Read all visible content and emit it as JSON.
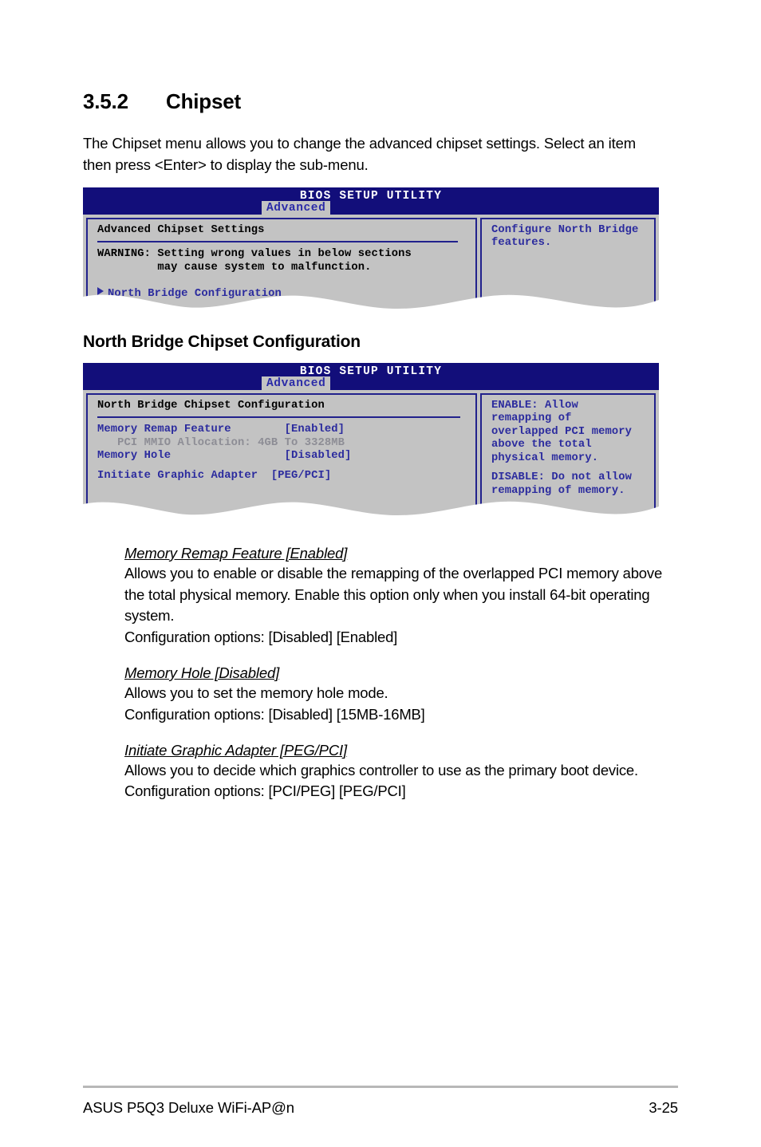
{
  "section": {
    "number": "3.5.2",
    "title": "Chipset",
    "intro": "The Chipset menu allows you to change the advanced chipset settings. Select an item then press <Enter> to display the sub-menu.",
    "subheading": "North Bridge Chipset Configuration"
  },
  "bios_screen_1": {
    "title": "BIOS SETUP UTILITY",
    "active_tab": "Advanced",
    "left_pane": {
      "heading": "Advanced Chipset Settings",
      "warning_line1": "WARNING: Setting wrong values in below sections",
      "warning_line2": "         may cause system to malfunction.",
      "submenu_item": "North Bridge Configuration"
    },
    "right_pane": {
      "help_line1": "Configure North Bridge",
      "help_line2": "features."
    }
  },
  "bios_screen_2": {
    "title": "BIOS SETUP UTILITY",
    "active_tab": "Advanced",
    "left_pane": {
      "heading": "North Bridge Chipset Configuration",
      "items": [
        {
          "label": "Memory Remap Feature",
          "value": "[Enabled]"
        },
        {
          "label": "  PCI MMIO Allocation: 4GB To 3328MB",
          "value": ""
        },
        {
          "label": "Memory Hole",
          "value": "[Disabled]"
        },
        {
          "label": "Initiate Graphic Adapter",
          "value": "[PEG/PCI]"
        }
      ],
      "row1_label": "Memory Remap Feature",
      "row1_value": "[Enabled]",
      "row2_text": "   PCI MMIO Allocation: 4GB To 3328MB",
      "row3_label": "Memory Hole",
      "row3_value": "[Disabled]",
      "row4_text": "Initiate Graphic Adapter  [PEG/PCI]"
    },
    "right_pane": {
      "help_enable_l1": "ENABLE: Allow",
      "help_enable_l2": "remapping of",
      "help_enable_l3": "overlapped PCI memory",
      "help_enable_l4": "above the total",
      "help_enable_l5": "physical memory.",
      "help_disable_l1": "DISABLE: Do not allow",
      "help_disable_l2": "remapping of memory."
    }
  },
  "descriptions": [
    {
      "title": "Memory Remap Feature [Enabled]",
      "body": "Allows you to enable or disable the remapping of the overlapped PCI memory above the total physical memory. Enable this option only when you install 64-bit operating system.",
      "options": "Configuration options: [Disabled] [Enabled]"
    },
    {
      "title": "Memory Hole [Disabled]",
      "body": "Allows you to set the memory hole mode.",
      "options": "Configuration options: [Disabled] [15MB-16MB]"
    },
    {
      "title": "Initiate Graphic Adapter [PEG/PCI]",
      "body": "Allows you to decide which graphics controller to use as the primary boot device.",
      "options": "Configuration options: [PCI/PEG] [PEG/PCI]"
    }
  ],
  "footer": {
    "product": "ASUS P5Q3 Deluxe WiFi-AP@n",
    "page_number": "3-25"
  },
  "colors": {
    "bios_header_blue": "#120e7a",
    "bios_border_blue": "#21218c",
    "bios_body_gray": "#c3c3c3",
    "bios_text_blue": "#2b2b9e",
    "bios_text_gray": "#8d8d95",
    "footer_rule": "#b8b8b8"
  }
}
